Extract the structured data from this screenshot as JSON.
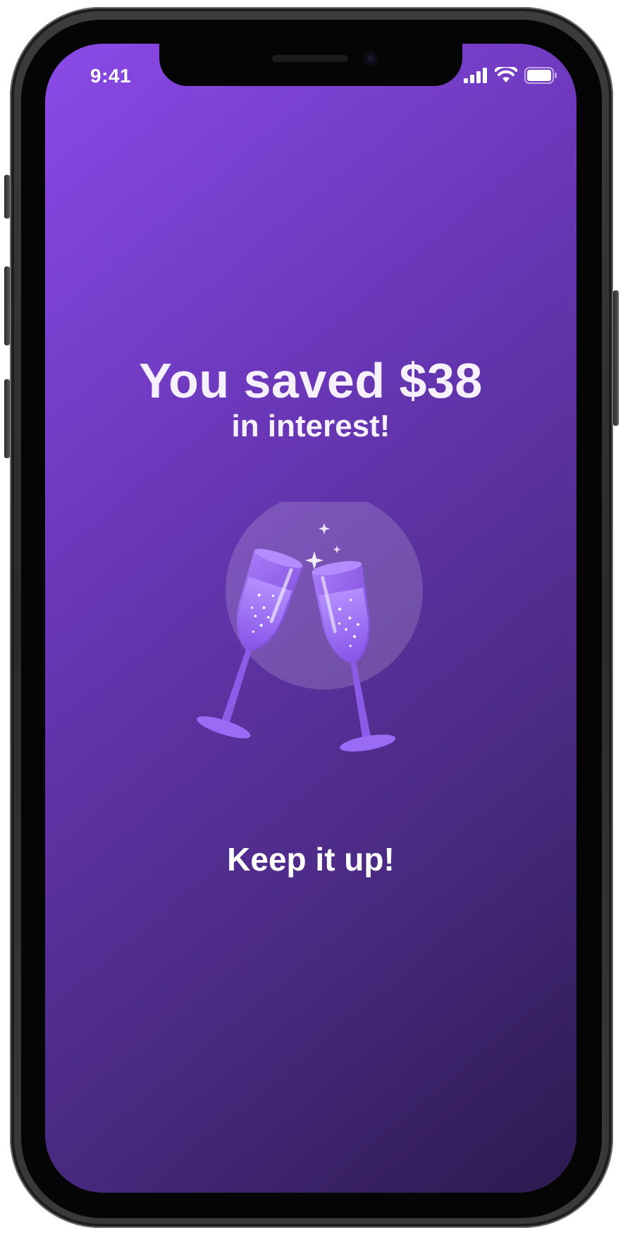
{
  "status_bar": {
    "time": "9:41",
    "icons": [
      "signal-icon",
      "wifi-icon",
      "battery-icon"
    ]
  },
  "content": {
    "headline": "You saved $38",
    "subheadline": "in interest!",
    "illustration": "champagne-toast-icon",
    "footer": "Keep it up!"
  },
  "colors": {
    "gradient_start": "#8b4ae8",
    "gradient_end": "#2c1a4f",
    "text": "#f6f0ff",
    "glass": "#8f5ef0"
  }
}
